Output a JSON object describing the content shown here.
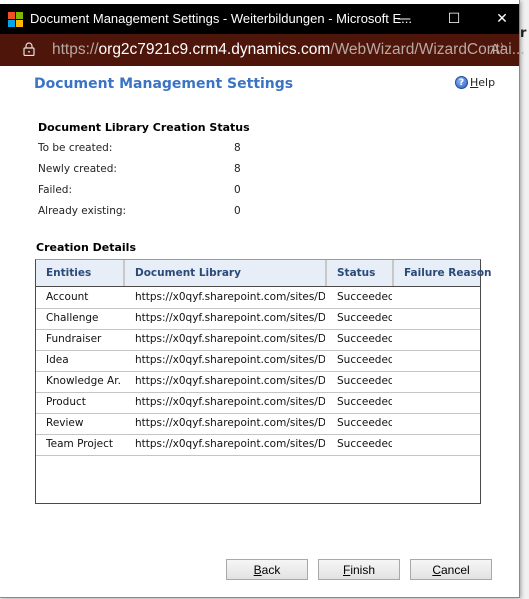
{
  "window": {
    "title": "Document Management Settings - Weiterbildungen - Microsoft E...",
    "controls": {
      "minimize": "—",
      "maximize": "☐",
      "close": "✕"
    }
  },
  "addressbar": {
    "scheme": "https://",
    "host": "org2c7921c9.crm4.dynamics.com",
    "path": "/WebWizard/WizardContai...",
    "read_aloud": "A⁾"
  },
  "outside_peek": "r",
  "header": {
    "title": "Document Management Settings",
    "help_accesskey": "H",
    "help_rest": "elp"
  },
  "status": {
    "title": "Document Library Creation Status",
    "rows": [
      {
        "label": "To be created:",
        "value": "8"
      },
      {
        "label": "Newly created:",
        "value": "8"
      },
      {
        "label": "Failed:",
        "value": "0"
      },
      {
        "label": "Already existing:",
        "value": "0"
      }
    ]
  },
  "details": {
    "title": "Creation Details",
    "columns": [
      "Entities",
      "Document Library",
      "Status",
      "Failure Reason"
    ],
    "rows": [
      {
        "entity": "Account",
        "library": "https://x0qyf.sharepoint.com/sites/D...",
        "status": "Succeeded",
        "reason": ""
      },
      {
        "entity": "Challenge",
        "library": "https://x0qyf.sharepoint.com/sites/D...",
        "status": "Succeeded",
        "reason": ""
      },
      {
        "entity": "Fundraiser",
        "library": "https://x0qyf.sharepoint.com/sites/D...",
        "status": "Succeeded",
        "reason": ""
      },
      {
        "entity": "Idea",
        "library": "https://x0qyf.sharepoint.com/sites/D...",
        "status": "Succeeded",
        "reason": ""
      },
      {
        "entity": "Knowledge Ar...",
        "library": "https://x0qyf.sharepoint.com/sites/D...",
        "status": "Succeeded",
        "reason": ""
      },
      {
        "entity": "Product",
        "library": "https://x0qyf.sharepoint.com/sites/D...",
        "status": "Succeeded",
        "reason": ""
      },
      {
        "entity": "Review",
        "library": "https://x0qyf.sharepoint.com/sites/D...",
        "status": "Succeeded",
        "reason": ""
      },
      {
        "entity": "Team Project",
        "library": "https://x0qyf.sharepoint.com/sites/D...",
        "status": "Succeeded",
        "reason": ""
      }
    ]
  },
  "buttons": {
    "back": {
      "key": "B",
      "rest": "ack"
    },
    "finish": {
      "key": "F",
      "rest": "inish"
    },
    "cancel": {
      "key": "C",
      "rest": "ancel"
    }
  },
  "colors": {
    "title_blue": "#3b74c4",
    "addressbar_bg": "#4e160b",
    "ms_red": "#f25022",
    "ms_green": "#7fba00",
    "ms_blue": "#00a4ef",
    "ms_yellow": "#ffb900"
  }
}
